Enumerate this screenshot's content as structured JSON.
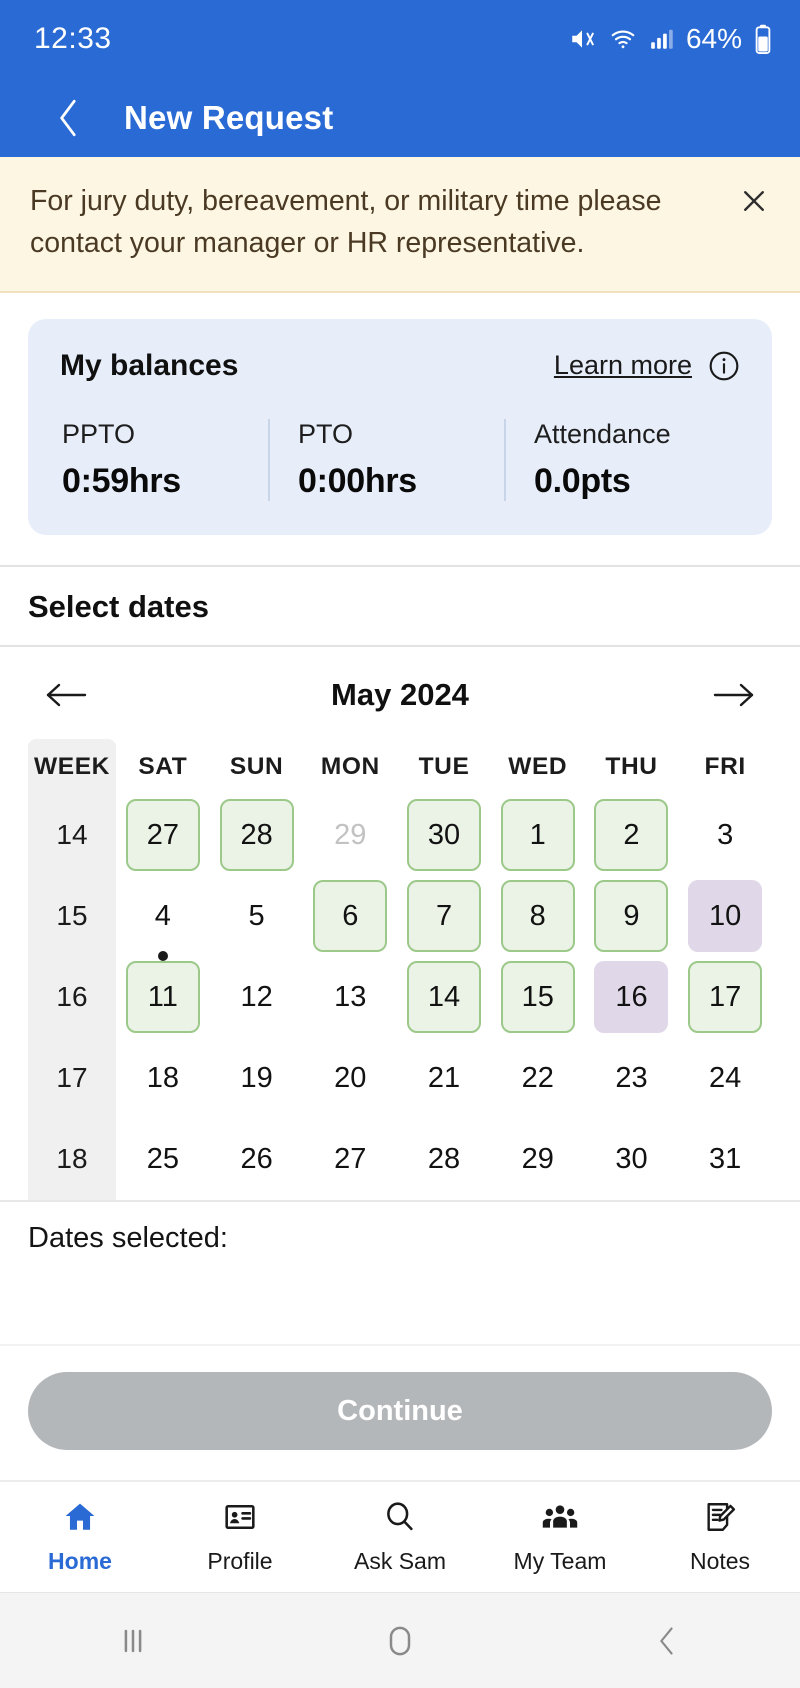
{
  "status_bar": {
    "time": "12:33",
    "battery_percent": "64%",
    "icons": [
      "mute-icon",
      "wifi-icon",
      "cellular-signal-icon",
      "battery-icon"
    ]
  },
  "app_bar": {
    "title": "New Request",
    "back_icon": "back-chevron-icon"
  },
  "banner": {
    "message": "For jury duty, bereavement, or military time please contact your manager or HR representative.",
    "close_icon": "close-icon",
    "background": "#fdf6e3"
  },
  "balances": {
    "title": "My balances",
    "learn_more_label": "Learn more",
    "info_icon": "info-icon",
    "items": [
      {
        "label": "PPTO",
        "value": "0:59hrs"
      },
      {
        "label": "PTO",
        "value": "0:00hrs"
      },
      {
        "label": "Attendance",
        "value": "0.0pts"
      }
    ],
    "card_background": "#e7eefa"
  },
  "select_dates": {
    "heading": "Select dates"
  },
  "calendar": {
    "month_label": "May 2024",
    "prev_icon": "arrow-left-icon",
    "next_icon": "arrow-right-icon",
    "week_column_header": "WEEK",
    "day_headers": [
      "SAT",
      "SUN",
      "MON",
      "TUE",
      "WED",
      "THU",
      "FRI"
    ],
    "legend": {
      "available_color": "#eaf3e6",
      "available_border": "#9cc98a",
      "holiday_color": "#e0d7e8"
    },
    "weeks": [
      {
        "week": "14",
        "days": [
          {
            "label": "27",
            "state": "available"
          },
          {
            "label": "28",
            "state": "available"
          },
          {
            "label": "29",
            "state": "disabled"
          },
          {
            "label": "30",
            "state": "available"
          },
          {
            "label": "1",
            "state": "available"
          },
          {
            "label": "2",
            "state": "available"
          },
          {
            "label": "3",
            "state": "plain"
          }
        ]
      },
      {
        "week": "15",
        "days": [
          {
            "label": "4",
            "state": "plain",
            "today": true
          },
          {
            "label": "5",
            "state": "plain"
          },
          {
            "label": "6",
            "state": "available"
          },
          {
            "label": "7",
            "state": "available"
          },
          {
            "label": "8",
            "state": "available"
          },
          {
            "label": "9",
            "state": "available"
          },
          {
            "label": "10",
            "state": "holiday"
          }
        ]
      },
      {
        "week": "16",
        "days": [
          {
            "label": "11",
            "state": "available"
          },
          {
            "label": "12",
            "state": "plain"
          },
          {
            "label": "13",
            "state": "plain"
          },
          {
            "label": "14",
            "state": "available"
          },
          {
            "label": "15",
            "state": "available"
          },
          {
            "label": "16",
            "state": "holiday"
          },
          {
            "label": "17",
            "state": "available"
          }
        ]
      },
      {
        "week": "17",
        "days": [
          {
            "label": "18",
            "state": "plain"
          },
          {
            "label": "19",
            "state": "plain"
          },
          {
            "label": "20",
            "state": "plain"
          },
          {
            "label": "21",
            "state": "plain"
          },
          {
            "label": "22",
            "state": "plain"
          },
          {
            "label": "23",
            "state": "plain"
          },
          {
            "label": "24",
            "state": "plain"
          }
        ]
      },
      {
        "week": "18",
        "days": [
          {
            "label": "25",
            "state": "plain"
          },
          {
            "label": "26",
            "state": "plain"
          },
          {
            "label": "27",
            "state": "plain"
          },
          {
            "label": "28",
            "state": "plain"
          },
          {
            "label": "29",
            "state": "plain"
          },
          {
            "label": "30",
            "state": "plain"
          },
          {
            "label": "31",
            "state": "plain"
          }
        ]
      }
    ]
  },
  "dates_selected": {
    "label": "Dates selected:",
    "value": ""
  },
  "continue": {
    "label": "Continue",
    "enabled": false,
    "color": "#b4b7ba"
  },
  "bottom_nav": {
    "items": [
      {
        "label": "Home",
        "icon": "home-icon",
        "active": true
      },
      {
        "label": "Profile",
        "icon": "id-card-icon",
        "active": false
      },
      {
        "label": "Ask Sam",
        "icon": "search-icon",
        "active": false
      },
      {
        "label": "My Team",
        "icon": "people-group-icon",
        "active": false
      },
      {
        "label": "Notes",
        "icon": "note-edit-icon",
        "active": false
      }
    ],
    "active_color": "#2a6ad4"
  },
  "system_nav": {
    "items": [
      "recents-icon",
      "home-circle-icon",
      "back-icon"
    ]
  }
}
